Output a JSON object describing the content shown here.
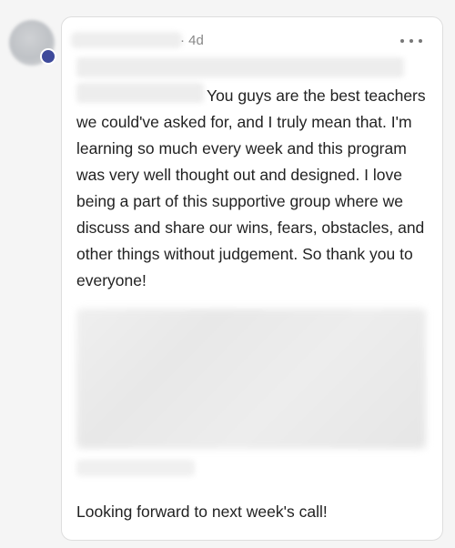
{
  "post": {
    "time_meta": "· 4d",
    "body": "You guys are the best teachers we could've asked for, and I truly mean that. I'm learning so much every week and this program was very well thought out and designed. I love being a part of this supportive group where we discuss and share our wins, fears, obstacles, and other things without judgement. So thank you to everyone!",
    "closing": "Looking forward to next week's call!"
  },
  "icons": {
    "more": "more-horizontal-icon"
  },
  "colors": {
    "avatar_badge": "#3e4a9b",
    "text": "#222222",
    "meta": "#888888"
  }
}
